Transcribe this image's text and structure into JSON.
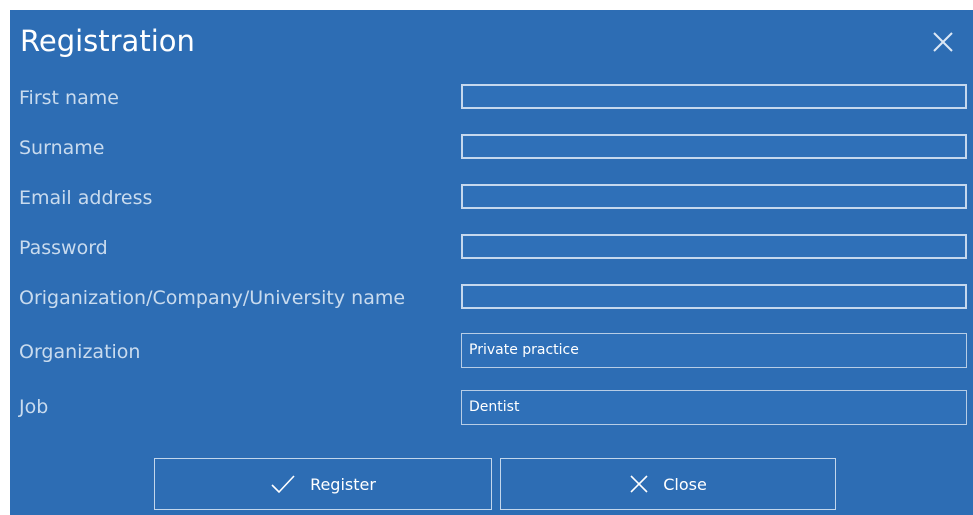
{
  "dialog": {
    "title": "Registration"
  },
  "fields": {
    "first_name_label": "First name",
    "surname_label": "Surname",
    "email_label": "Email address",
    "password_label": "Password",
    "org_name_label": "Origanization/Company/University name",
    "organization_label": "Organization",
    "organization_value": "Private practice",
    "job_label": "Job",
    "job_value": "Dentist"
  },
  "buttons": {
    "register_label": "Register",
    "close_label": "Close"
  },
  "colors": {
    "dialog_bg": "#2d6db4",
    "field_border": "#c5d8ee",
    "label_text": "#c9dbee"
  }
}
